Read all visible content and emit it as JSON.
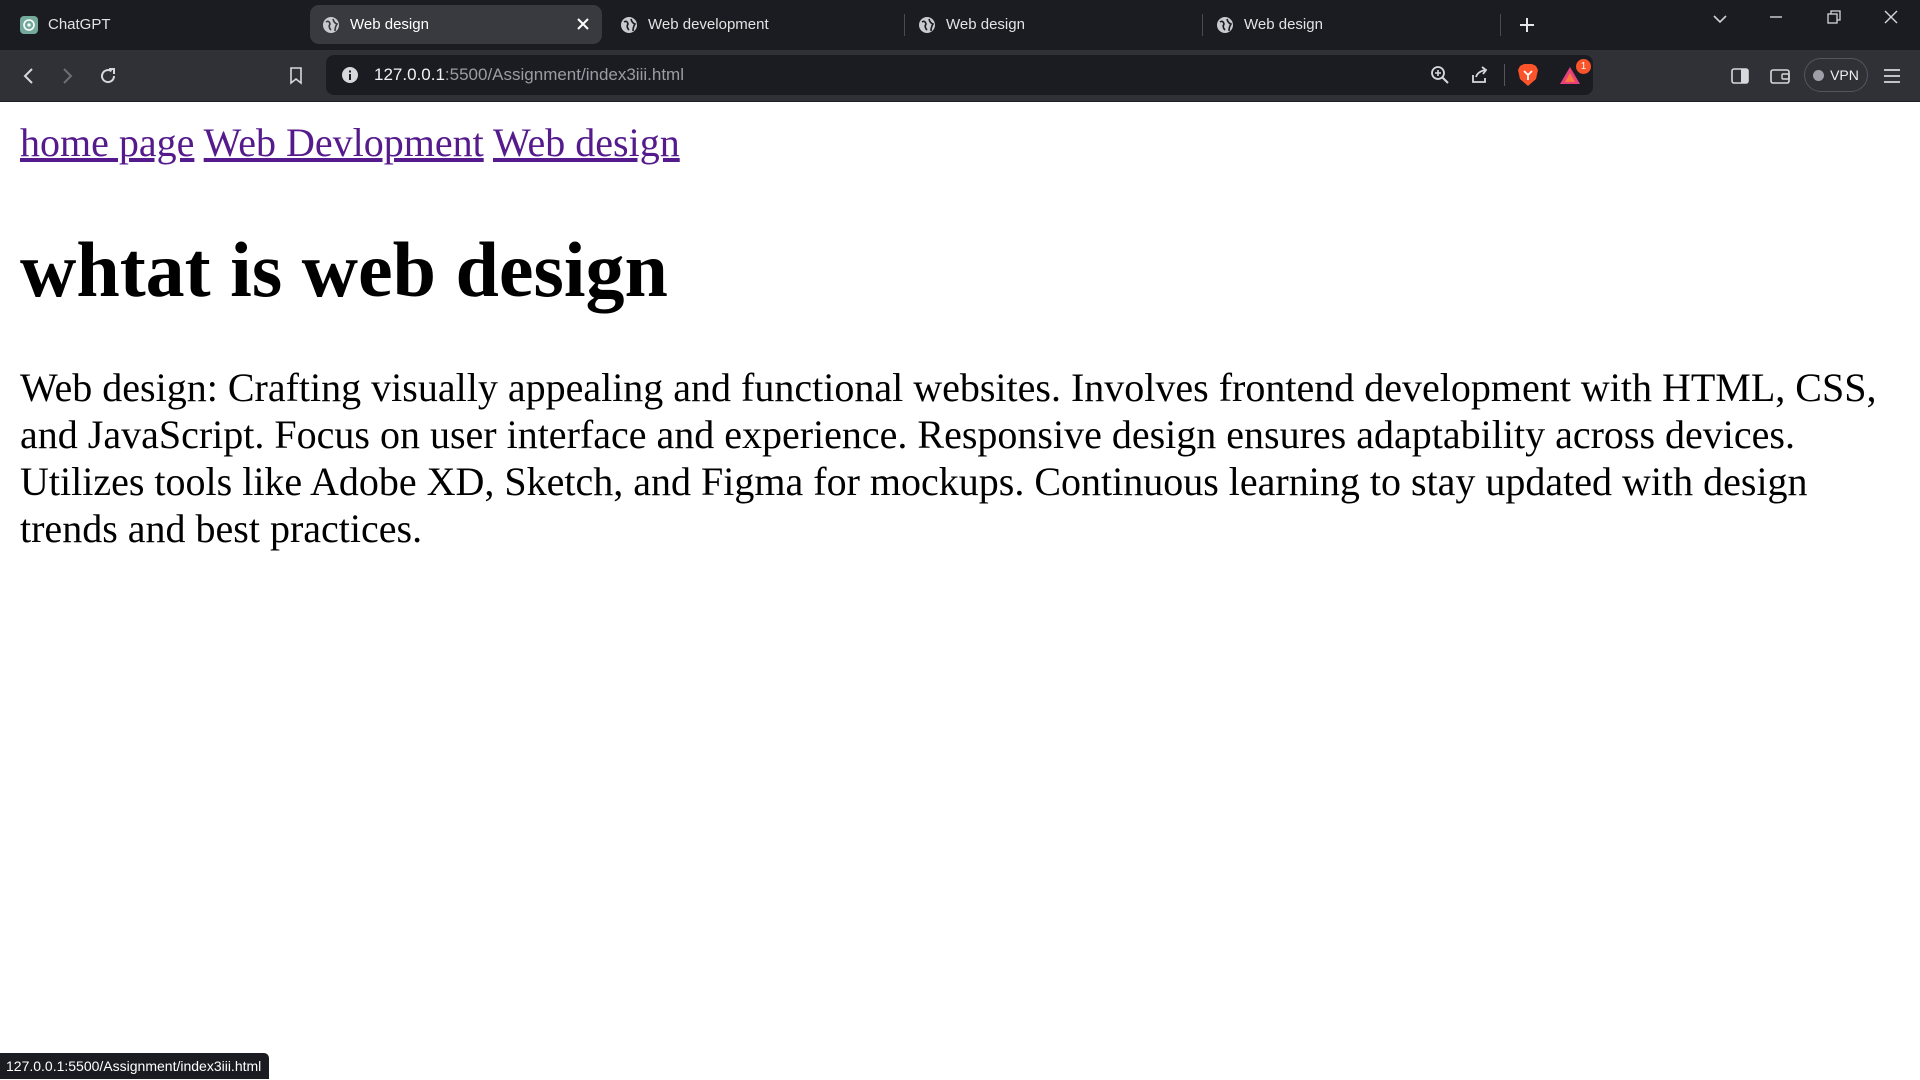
{
  "tabs": [
    {
      "title": "ChatGPT",
      "active": false,
      "favicon": "chatgpt-icon"
    },
    {
      "title": "Web design",
      "active": true,
      "favicon": "globe-icon"
    },
    {
      "title": "Web development",
      "active": false,
      "favicon": "globe-icon"
    },
    {
      "title": "Web design",
      "active": false,
      "favicon": "globe-icon"
    },
    {
      "title": "Web design",
      "active": false,
      "favicon": "globe-icon"
    }
  ],
  "address_bar": {
    "host": "127.0.0.1",
    "rest": ":5500/Assignment/index3iii.html"
  },
  "toolbar": {
    "vpn_label": "VPN",
    "rewards_badge": "1"
  },
  "page": {
    "nav_links": [
      "home page",
      "Web Devlopment",
      "Web design"
    ],
    "heading": "whtat is web design",
    "paragraph": "Web design: Crafting visually appealing and functional websites. Involves frontend development with HTML, CSS, and JavaScript. Focus on user interface and experience. Responsive design ensures adaptability across devices. Utilizes tools like Adobe XD, Sketch, and Figma for mockups. Continuous learning to stay updated with design trends and best practices."
  },
  "status_bar": {
    "text": "127.0.0.1:5500/Assignment/index3iii.html"
  },
  "colors": {
    "tabstrip_bg": "#1b1c21",
    "active_tab_bg": "#393a40",
    "toolbar_bg": "#303136",
    "visited_link": "#551a8b",
    "brave_orange": "#fb542b"
  }
}
